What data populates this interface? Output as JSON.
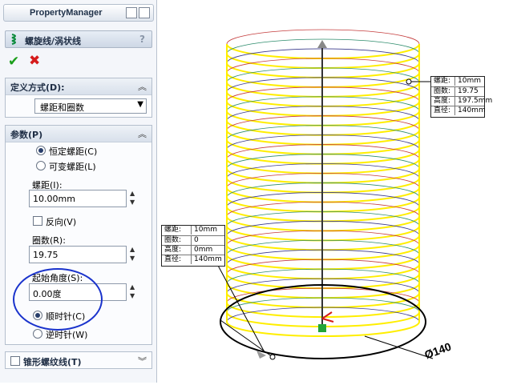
{
  "panel": {
    "title": "PropertyManager",
    "feature_title": "螺旋线/涡状线",
    "help": "?",
    "ok_icon": "check-icon",
    "cancel_icon": "close-icon"
  },
  "define_by": {
    "header": "定义方式(D):",
    "value": "螺距和圈数"
  },
  "params": {
    "header": "参数(P)",
    "constant_pitch": "恒定螺距(C)",
    "variable_pitch": "可变螺距(L)",
    "pitch_label": "螺距(I):",
    "pitch_value": "10.00mm",
    "reverse_label": "反向(V)",
    "revolutions_label": "圈数(R):",
    "revolutions_value": "19.75",
    "start_angle_label": "起始角度(S):",
    "start_angle_value": "0.00度",
    "clockwise": "顺时针(C)",
    "counterclockwise": "逆时针(W)"
  },
  "taper": {
    "header": "锥形螺纹线(T)"
  },
  "callout_top": {
    "rows": [
      {
        "k": "螺距:",
        "v": "10mm"
      },
      {
        "k": "圈数:",
        "v": "19.75"
      },
      {
        "k": "高度:",
        "v": "197.5mm"
      },
      {
        "k": "直径:",
        "v": "140mm"
      }
    ]
  },
  "callout_bottom": {
    "rows": [
      {
        "k": "螺距:",
        "v": "10mm"
      },
      {
        "k": "圈数:",
        "v": "0"
      },
      {
        "k": "高度:",
        "v": "0mm"
      },
      {
        "k": "直径:",
        "v": "140mm"
      }
    ]
  },
  "dimension": "Ø140",
  "colors": {
    "helix": "#ffee00",
    "accent_circle": "#1a33cc",
    "ok": "#1a9e1a",
    "cancel": "#d51b1b"
  }
}
